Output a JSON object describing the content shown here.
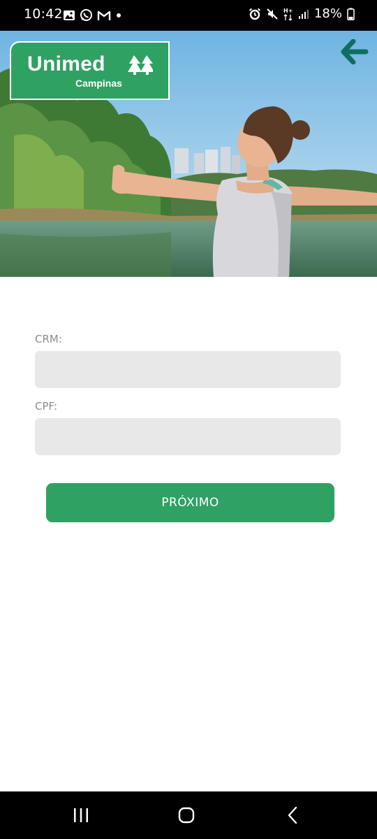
{
  "status_bar": {
    "time": "10:42",
    "battery": "18%",
    "left_icons": [
      "gallery-icon",
      "whatsapp-icon",
      "gmail-icon",
      "dot-icon"
    ],
    "right_icons": [
      "alarm-icon",
      "mute-icon",
      "hplus-data-icon",
      "signal-icon",
      "battery-icon"
    ]
  },
  "header": {
    "logo_text": "Unimed",
    "logo_subtext": "Campinas",
    "back_icon": "arrow-left-icon"
  },
  "form": {
    "crm_label": "CRM:",
    "crm_value": "",
    "cpf_label": "CPF:",
    "cpf_value": "",
    "next_label": "PRÓXIMO"
  },
  "colors": {
    "brand_green": "#2fa163",
    "back_arrow": "#0e6e63",
    "input_bg": "#e8e8e8",
    "label_gray": "#8c8c8c"
  },
  "nav_bar": {
    "icons": [
      "recents-icon",
      "home-icon",
      "back-icon"
    ]
  }
}
